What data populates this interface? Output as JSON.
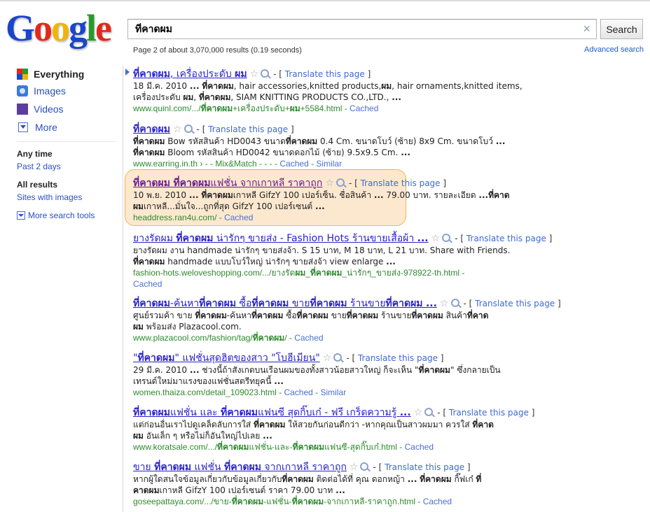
{
  "logo": {
    "letters": [
      "G",
      "o",
      "o",
      "g",
      "l",
      "e"
    ]
  },
  "search": {
    "query": "ที่คาดผม",
    "button_label": "Search",
    "clear_icon": "×"
  },
  "stats": "Page 2 of about 3,070,000 results (0.19 seconds)",
  "advanced_search": "Advanced search",
  "sidebar": {
    "nav": [
      {
        "label": "Everything",
        "icon": "everything-icon",
        "active": true
      },
      {
        "label": "Images",
        "icon": "images-icon"
      },
      {
        "label": "Videos",
        "icon": "videos-icon"
      },
      {
        "label": "More",
        "icon": "more-icon"
      }
    ],
    "time_head": "Any time",
    "time_link": "Past 2 days",
    "results_head": "All results",
    "results_link": "Sites with images",
    "more_tools": "More search tools"
  },
  "translate_label": "Translate this page",
  "cached_label": "Cached",
  "similar_label": "Similar",
  "results": [
    {
      "title": "<b>ที่คาดผม</b>, เครื่องประดับ <b>ผม</b>",
      "snippet": "18 มี.ค. 2010 <b>...</b> <b>ที่คาดผม</b>, hair accessories,knitted products,<b>ผม</b>, hair ornaments,knitted items,<br>เครื่องประดับ <b>ผม</b>, <b>ที่คาดผม</b>, SIAM KNITTING PRODUCTS CO.,LTD., <b>...</b>",
      "url": "www.quinl.com/.../<b>ที่คาดผม</b>+เครื่องประดับ+<b>ผม</b>+5584.html",
      "similar": false
    },
    {
      "title": "<b>ที่คาดผม</b>",
      "snippet": "<b>ที่คาดผม</b> Bow รหัสสินค้า HD0043 ขนาด<b>ที่คาดผม</b> 0.4 Cm. ขนาดโบว์ (ซ้าย) 8x9 Cm. ขนาดโบว์ <b>...</b><br><b>ที่คาดผม</b> Bloom รหัสสินค้า HD0042 ขนาดดอกไม้ (ซ้าย) 9.5x9.5 Cm. <b>...</b>",
      "url": "www.earring.in.th › - - Mix&Match - - -",
      "similar": true
    },
    {
      "title": "<b>ที่คาดผม</b> <b>ที่คาดผม</b>แฟชั่น จากเกาหลี ราคาถูก",
      "snippet": "10 พ.ย. 2010 <b>...</b> <b>ที่คาดผม</b>เกาหลี GifzY 100 เปอร์เซ็น. ชื่อสินค้า <b>...</b> 79.00 บาท. รายละเอียด <b>...</b><b>ที่คาด<br>ผม</b>เกาหลี...มั่นใจ...ถูกที่สุด GifzY 100 เปอร์เซนต์ <b>...</b>",
      "url": "headdress.ran4u.com/",
      "similar": false
    },
    {
      "title": "ยางรัดผม <b>ที่คาดผม</b> น่ารักๆ ขายส่ง - Fashion Hots ร้านขายเสื้อผ้า <b>...</b>",
      "snippet": "ยางรัดผม งาน handmade น่ารักๆ ขายส่งจ้า. S 15 บาท, M 18 บาท, L 21 บาท. Share with Friends.<br><b>ที่คาดผม</b> handmade แบบโบว์ใหญ่ น่ารักๆ ขายส่งจ้า view enlarge <b>...</b>",
      "url": "fashion-hots.weloveshopping.com/.../ยางรัด<b>ผม</b>_<b>ที่คาดผม</b>_น่ารักๆ_ขายส่ง-978922-th.html",
      "similar": false
    },
    {
      "title": "<b>ที่คาดผม</b>-ค้นหา<b>ที่คาดผม</b> ซื้อ<b>ที่คาดผม</b> ขาย<b>ที่คาดผม</b> ร้านขาย<b>ที่คาดผม</b> <b>...</b>",
      "snippet": "ศูนย์รวมค้า ขาย <b>ที่คาดผม</b>-ค้นหา<b>ที่คาดผม</b> ซื้อ<b>ที่คาดผม</b> ขาย<b>ที่คาดผม</b> ร้านขาย<b>ที่คาดผม</b> สินค้า<b>ที่คาด<br>ผม</b> พร้อมส่ง Plazacool.com.",
      "url": "www.plazacool.com/fashion/tag/<b>ที่คาดผม</b>/",
      "similar": false
    },
    {
      "title": "\"<b>ที่คาดผม</b>\" แฟชั่นสุดฮิตของสาว \"โบฮีเมียน\"",
      "snippet": "29 มี.ค. 2010 <b>...</b> ช่วงนี้ถ้าสังเกตบนเรือนผมของทั้งสาวน้อยสาวใหญ่ ก็จะเห็น \"<b>ที่คาดผม</b>\" ซึ่งกลายเป็น<br>เทรนด์ใหม่มาแรงของแฟชั่นสตรีทยุคนี้ <b>...</b>",
      "url": "women.thaiza.com/detail_109023.html",
      "similar": true
    },
    {
      "title": "<b>ที่คาดผม</b>แฟชั่น และ <b>ที่คาดผม</b>แฟนซี สุดกิ๊บเก๋ - ฟรี เกร็ดความรู้ <b>...</b>",
      "snippet": "แต่ก่อนอื่นเราไปดูเคล็ดลับการใส่ <b>ที่คาดผม</b> ให้สวยกันก่อนดีกว่า -หากคุณเป็นสาวผมมา ควรใส่ <b>ที่คาด<br>ผม</b> อันเล็ก ๆ หรือไม่ก็อันใหญ่ไปเลย <b>...</b>",
      "url": "www.koratsale.com/.../<b>ที่คาดผม</b>แฟชั่น-และ-<b>ที่คาดผม</b>แฟนซี-สุดกิ๊บเก๋.html",
      "similar": false
    },
    {
      "title": "ขาย <b>ที่คาดผม</b> แฟชั่น <b>ที่คาดผม</b> จากเกาหลี ราคาถูก",
      "snippet": "หากผู้ใดสนใจข้อมูลเกี่ยวกับข้อมูลเกี่ยวกับ<b>ที่คาดผม</b> ติดต่อได้ที่ คุณ ดอกหญ้า <b>...</b> <b>ที่คาดผม</b> กิ๊ฟเก๋ <b>ที่<br>คาดผม</b>เกาหลี GifzY 100 เปอร์เซนต์ ราคา 79.00 บาท <b>...</b>",
      "url": "goseepattaya.com/.../ขาย-<b>ที่คาดผม</b>-แฟชั่น-<b>ที่คาดผม</b>-จากเกาหลี-ราคาถูก.html",
      "similar": false
    }
  ]
}
